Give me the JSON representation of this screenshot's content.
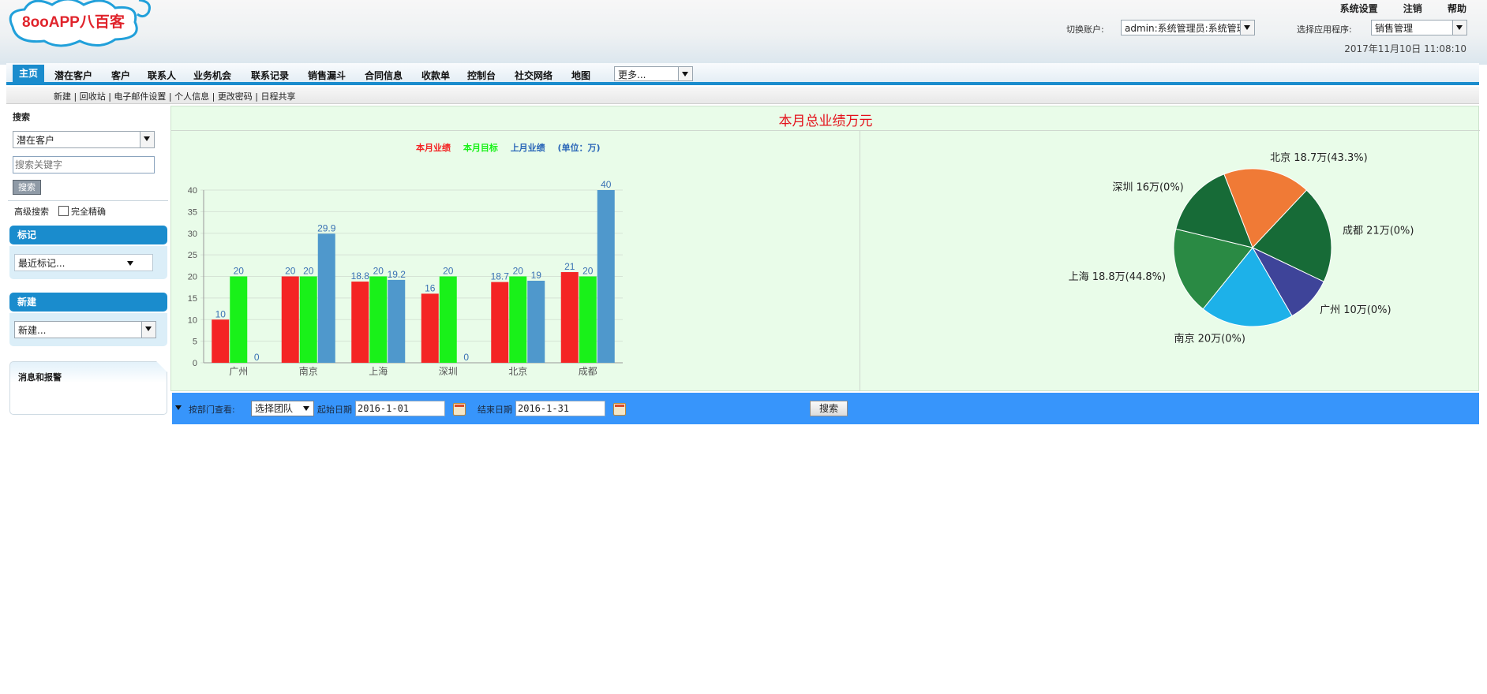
{
  "logo": {
    "text": "8ooAPP八百客"
  },
  "header": {
    "links": [
      "系统设置",
      "注销",
      "帮助"
    ],
    "switch_account_label": "切换账户:",
    "switch_account_value": "admin:系统管理员:系统管理员",
    "select_app_label": "选择应用程序:",
    "select_app_value": "销售管理",
    "datetime": "2017年11月10日 11:08:10"
  },
  "nav": {
    "tabs": [
      "主页",
      "潜在客户",
      "客户",
      "联系人",
      "业务机会",
      "联系记录",
      "销售漏斗",
      "合同信息",
      "收款单",
      "控制台",
      "社交网络",
      "地图"
    ],
    "more": "更多..."
  },
  "subnav": {
    "links": [
      "新建",
      "回收站",
      "电子邮件设置",
      "个人信息",
      "更改密码",
      "日程共享"
    ]
  },
  "sidebar": {
    "search_title": "搜索",
    "search_scope": "潜在客户",
    "search_placeholder": "搜索关键字",
    "search_button": "搜索",
    "advanced_search": "高级搜索",
    "exact_match": "完全精确",
    "tags_title": "标记",
    "recent_tags": "最近标记...",
    "new_title": "新建",
    "new_select": "新建...",
    "messages_title": "消息和报警"
  },
  "main": {
    "title": "本月总业绩万元",
    "legend": [
      "本月业绩",
      "本月目标",
      "上月业绩",
      "(单位：万)"
    ]
  },
  "filter": {
    "dept_label": "按部门查看:",
    "team_select": "选择团队",
    "start_label": "起始日期",
    "start_value": "2016-1-01",
    "end_label": "结束日期",
    "end_value": "2016-1-31",
    "search_button": "搜索"
  },
  "colors": {
    "accent": "#1a8ccd",
    "current": "#f42424",
    "target": "#19f119",
    "last": "#4f98cc",
    "filter_bar": "#3795fb",
    "chart_bg": "#e9fce9"
  },
  "chart_data": [
    {
      "type": "bar",
      "categories": [
        "广州",
        "南京",
        "上海",
        "深圳",
        "北京",
        "成都"
      ],
      "series": [
        {
          "name": "本月业绩",
          "values": [
            10,
            20,
            18.8,
            16,
            18.7,
            21
          ],
          "color": "#f42424"
        },
        {
          "name": "本月目标",
          "values": [
            20,
            20,
            20,
            20,
            20,
            20
          ],
          "color": "#19f119"
        },
        {
          "name": "上月业绩",
          "values": [
            0,
            29.9,
            19.2,
            0,
            19,
            40
          ],
          "color": "#4f98cc"
        }
      ],
      "yticks": [
        0,
        5,
        10,
        15,
        20,
        25,
        30,
        35,
        40
      ],
      "ylim": [
        0,
        40
      ],
      "grid": true
    },
    {
      "type": "pie",
      "slices": [
        {
          "label": "北京 18.7万(43.3%)",
          "value": 18.7,
          "color": "#f07a36"
        },
        {
          "label": "成都 21万(0%)",
          "value": 21,
          "color": "#176b37"
        },
        {
          "label": "广州 10万(0%)",
          "value": 10,
          "color": "#3e4499"
        },
        {
          "label": "南京 20万(0%)",
          "value": 20,
          "color": "#1db1e9"
        },
        {
          "label": "上海 18.8万(44.8%)",
          "value": 18.8,
          "color": "#2a8a44"
        },
        {
          "label": "深圳 16万(0%)",
          "value": 16,
          "color": "#176b37"
        }
      ]
    }
  ]
}
